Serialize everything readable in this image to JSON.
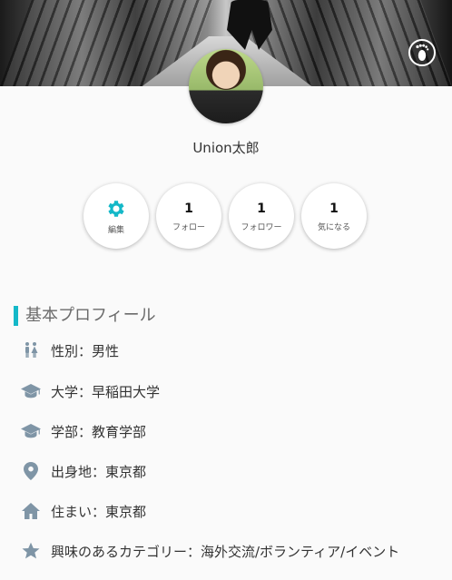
{
  "profile": {
    "name": "Union太郎"
  },
  "stats": [
    {
      "value": "",
      "label": "編集",
      "icon": "gear-icon"
    },
    {
      "value": "1",
      "label": "フォロー"
    },
    {
      "value": "1",
      "label": "フォロワー"
    },
    {
      "value": "1",
      "label": "気になる"
    }
  ],
  "section": {
    "title": "基本プロフィール"
  },
  "details": [
    {
      "icon": "gender-icon",
      "text": "性別：男性"
    },
    {
      "icon": "graduation-cap-icon",
      "text": "大学：早稲田大学"
    },
    {
      "icon": "graduation-cap-icon",
      "text": "学部：教育学部"
    },
    {
      "icon": "location-pin-icon",
      "text": "出身地：東京都"
    },
    {
      "icon": "home-icon",
      "text": "住まい：東京都"
    },
    {
      "icon": "star-icon",
      "text": "興味のあるカテゴリー：海外交流/ボランティア/イベント"
    }
  ],
  "colors": {
    "accent": "#14b8c8",
    "icon": "#7f95a6"
  }
}
